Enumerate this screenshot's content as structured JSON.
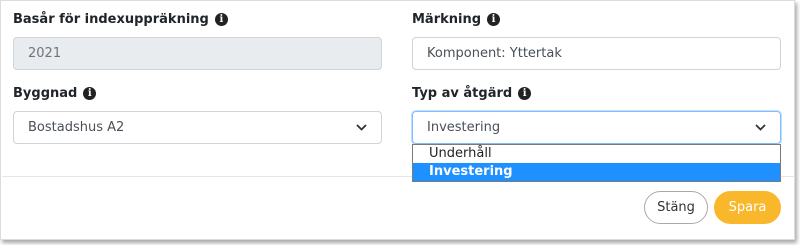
{
  "form": {
    "base_year": {
      "label": "Basår för indexuppräkning",
      "value": "2021"
    },
    "marking": {
      "label": "Märkning",
      "value": "Komponent: Yttertak"
    },
    "building": {
      "label": "Byggnad",
      "value": "Bostadshus A2"
    },
    "action_type": {
      "label": "Typ av åtgärd",
      "value": "Investering",
      "options": [
        "Underhåll",
        "Investering"
      ],
      "selected_index": 1
    }
  },
  "icons": {
    "info": "i"
  },
  "footer": {
    "close_label": "Stäng",
    "save_label": "Spara"
  },
  "colors": {
    "accent": "#f9b82c",
    "selected_option": "#1e90ff"
  }
}
